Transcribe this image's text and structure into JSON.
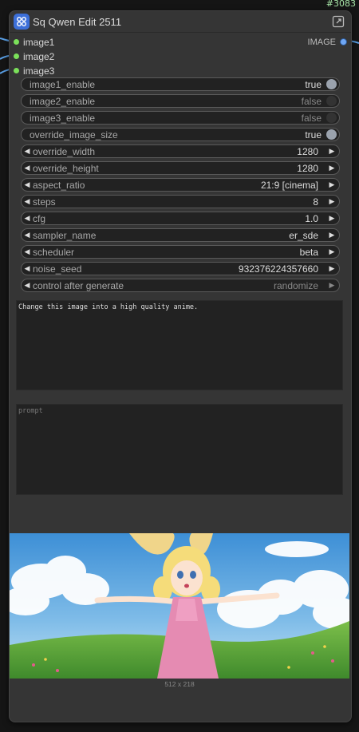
{
  "node_id": "#3083",
  "node": {
    "title": "Sq Qwen Edit 2511",
    "inputs": [
      "image1",
      "image2",
      "image3"
    ],
    "output": "IMAGE"
  },
  "widgets": {
    "image1_enable": {
      "label": "image1_enable",
      "value": "true"
    },
    "image2_enable": {
      "label": "image2_enable",
      "value": "false"
    },
    "image3_enable": {
      "label": "image3_enable",
      "value": "false"
    },
    "override_image_size": {
      "label": "override_image_size",
      "value": "true"
    },
    "override_width": {
      "label": "override_width",
      "value": "1280"
    },
    "override_height": {
      "label": "override_height",
      "value": "1280"
    },
    "aspect_ratio": {
      "label": "aspect_ratio",
      "value": "21:9 [cinema]"
    },
    "steps": {
      "label": "steps",
      "value": "8"
    },
    "cfg": {
      "label": "cfg",
      "value": "1.0"
    },
    "sampler_name": {
      "label": "sampler_name",
      "value": "er_sde"
    },
    "scheduler": {
      "label": "scheduler",
      "value": "beta"
    },
    "noise_seed": {
      "label": "noise_seed",
      "value": "932376224357660"
    },
    "control_after_generate": {
      "label": "control after generate",
      "value": "randomize"
    }
  },
  "prompt_text": "Change this image into a high quality anime.",
  "negative_placeholder": "prompt",
  "preview": {
    "dimensions": "512 x 218"
  }
}
